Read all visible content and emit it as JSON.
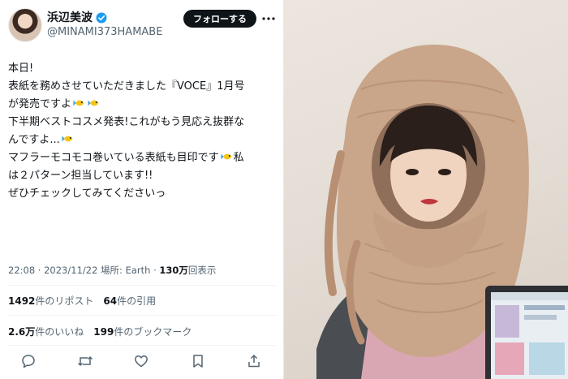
{
  "user": {
    "name": "浜辺美波",
    "handle": "@MINAMI373HAMABE",
    "follow_label": "フォローする"
  },
  "tweet_lines": [
    "本日!",
    "表紙を務めさせていただきました『VOCE』1月号",
    "が発売ですよ",
    "下半期ベストコスメ発表!これがもう見応え抜群な",
    "んですよ...",
    "マフラーモコモコ巻いている表紙も目印です",
    "私",
    "は２パターン担当しています!!",
    "ぜひチェックしてみてくださいっ"
  ],
  "meta": {
    "time": "22:08 · 2023/11/22 場所: Earth · ",
    "views_count": "130万",
    "views_suffix": "回表示"
  },
  "stats": {
    "retweets_count": "1492",
    "retweets_label": "件のリポスト",
    "quotes_count": "64",
    "quotes_label": "件の引用",
    "likes_count": "2.6万",
    "likes_label": "件のいいね",
    "bookmarks_count": "199",
    "bookmarks_label": "件のブックマーク"
  },
  "icons": [
    "verified-icon",
    "more-icon",
    "fish-emoji-icon",
    "reply-icon",
    "retweet-icon",
    "like-icon",
    "bookmark-icon",
    "share-icon"
  ],
  "colors": {
    "follow_button_bg": "#0f1419",
    "verified": "#1d9bf0",
    "muted_text": "#536471",
    "scarf": "#c9a58a"
  }
}
